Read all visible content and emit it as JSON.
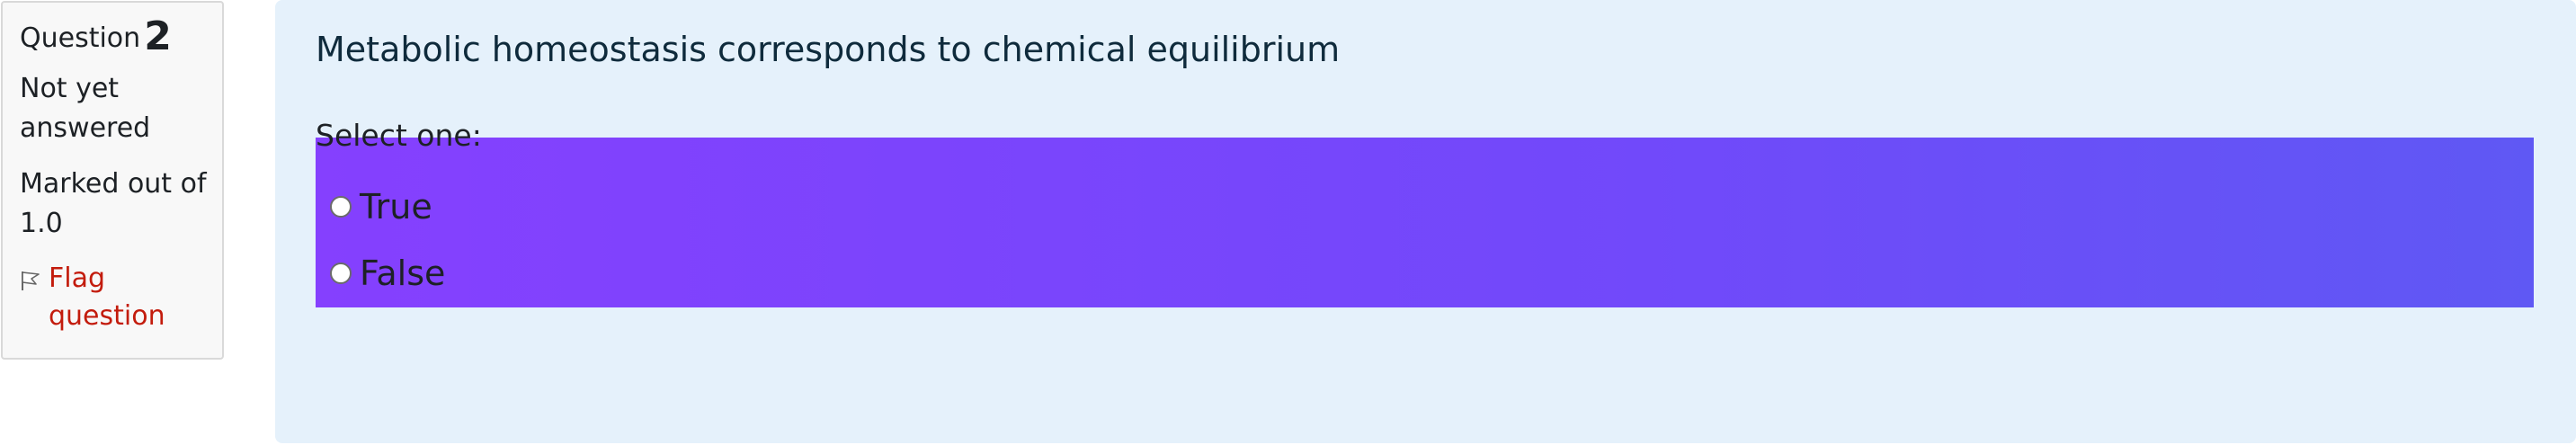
{
  "info": {
    "question_label": "Question",
    "question_number": "2",
    "status": "Not yet answered",
    "marks": "Marked out of 1.0",
    "flag_label": "Flag question",
    "flag_icon": "flag-icon"
  },
  "question": {
    "text": "Metabolic homeostasis corresponds to chemical equilibrium",
    "prompt": "Select one:",
    "options": [
      {
        "label": "True",
        "selected": false
      },
      {
        "label": "False",
        "selected": false
      }
    ]
  }
}
